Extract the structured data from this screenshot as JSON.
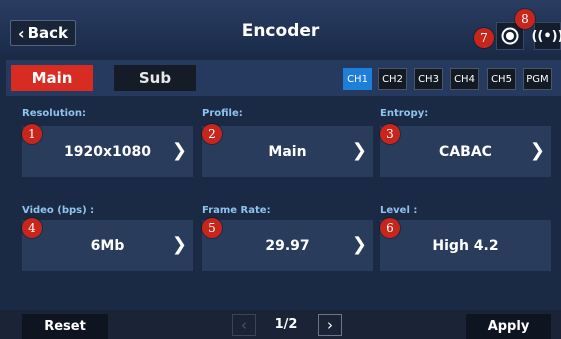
{
  "header": {
    "back_label": "Back",
    "title": "Encoder",
    "record_icon": "record-icon",
    "live_icon": "broadcast-icon",
    "live_glyph": "((•))"
  },
  "stream_tabs": [
    {
      "label": "Main",
      "active": true
    },
    {
      "label": "Sub",
      "active": false
    }
  ],
  "channels": [
    {
      "label": "CH1",
      "active": true
    },
    {
      "label": "CH2",
      "active": false
    },
    {
      "label": "CH3",
      "active": false
    },
    {
      "label": "CH4",
      "active": false
    },
    {
      "label": "CH5",
      "active": false
    },
    {
      "label": "PGM",
      "active": false
    }
  ],
  "fields": [
    {
      "label": "Resolution:",
      "value": "1920x1080",
      "badge": "1",
      "has_arrow": true
    },
    {
      "label": "Profile:",
      "value": "Main",
      "badge": "2",
      "has_arrow": true
    },
    {
      "label": "Entropy:",
      "value": "CABAC",
      "badge": "3",
      "has_arrow": true
    },
    {
      "label": "Video (bps) :",
      "value": "6Mb",
      "badge": "4",
      "has_arrow": true
    },
    {
      "label": "Frame Rate:",
      "value": "29.97",
      "badge": "5",
      "has_arrow": true
    },
    {
      "label": "Level :",
      "value": "High 4.2",
      "badge": "6",
      "has_arrow": false
    }
  ],
  "badges": {
    "record": "7",
    "live": "8"
  },
  "footer": {
    "reset_label": "Reset",
    "apply_label": "Apply",
    "page": "1/2"
  },
  "colors": {
    "accent_red": "#d82b21",
    "channel_active": "#1d7fd8",
    "label_blue": "#8fc3ee",
    "background": "#1b2a44"
  }
}
